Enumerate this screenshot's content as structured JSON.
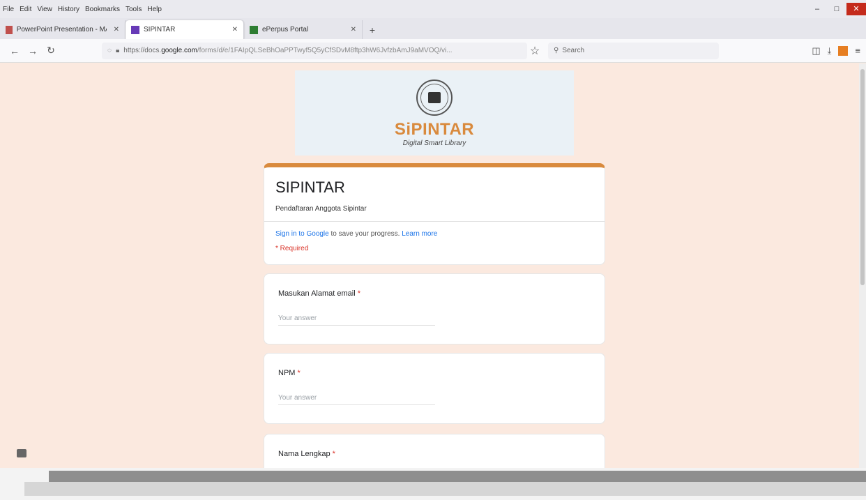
{
  "menu": [
    "File",
    "Edit",
    "View",
    "History",
    "Bookmarks",
    "Tools",
    "Help"
  ],
  "tabs": [
    {
      "label": "PowerPoint Presentation - MAKALA",
      "active": false
    },
    {
      "label": "SIPINTAR",
      "active": true
    },
    {
      "label": "ePerpus Portal",
      "active": false
    }
  ],
  "nav": {
    "url_prefix": "https://docs.",
    "url_domain": "google.com",
    "url_path": "/forms/d/e/1FAIpQLSeBhOaPPTwyf5Q5yCfSDvM8ftp3hW6JvfzbAmJ9aMVOQ/vi...",
    "search_placeholder": "Search"
  },
  "banner": {
    "brand": "SiPINTAR",
    "tagline": "Digital Smart Library"
  },
  "form": {
    "title": "SIPINTAR",
    "description": "Pendaftaran Anggota Sipintar",
    "signin_link": "Sign in to Google",
    "signin_text": " to save your progress.",
    "learn_more": "Learn more",
    "required_note": "* Required"
  },
  "questions": [
    {
      "label": "Masukan Alamat email",
      "placeholder": "Your answer"
    },
    {
      "label": "NPM",
      "placeholder": "Your answer"
    },
    {
      "label": "Nama Lengkap",
      "placeholder": ""
    }
  ],
  "colors": {
    "accent": "#d98a3d",
    "page_bg": "#fbe9df",
    "link": "#1a73e8",
    "required": "#d93025"
  }
}
